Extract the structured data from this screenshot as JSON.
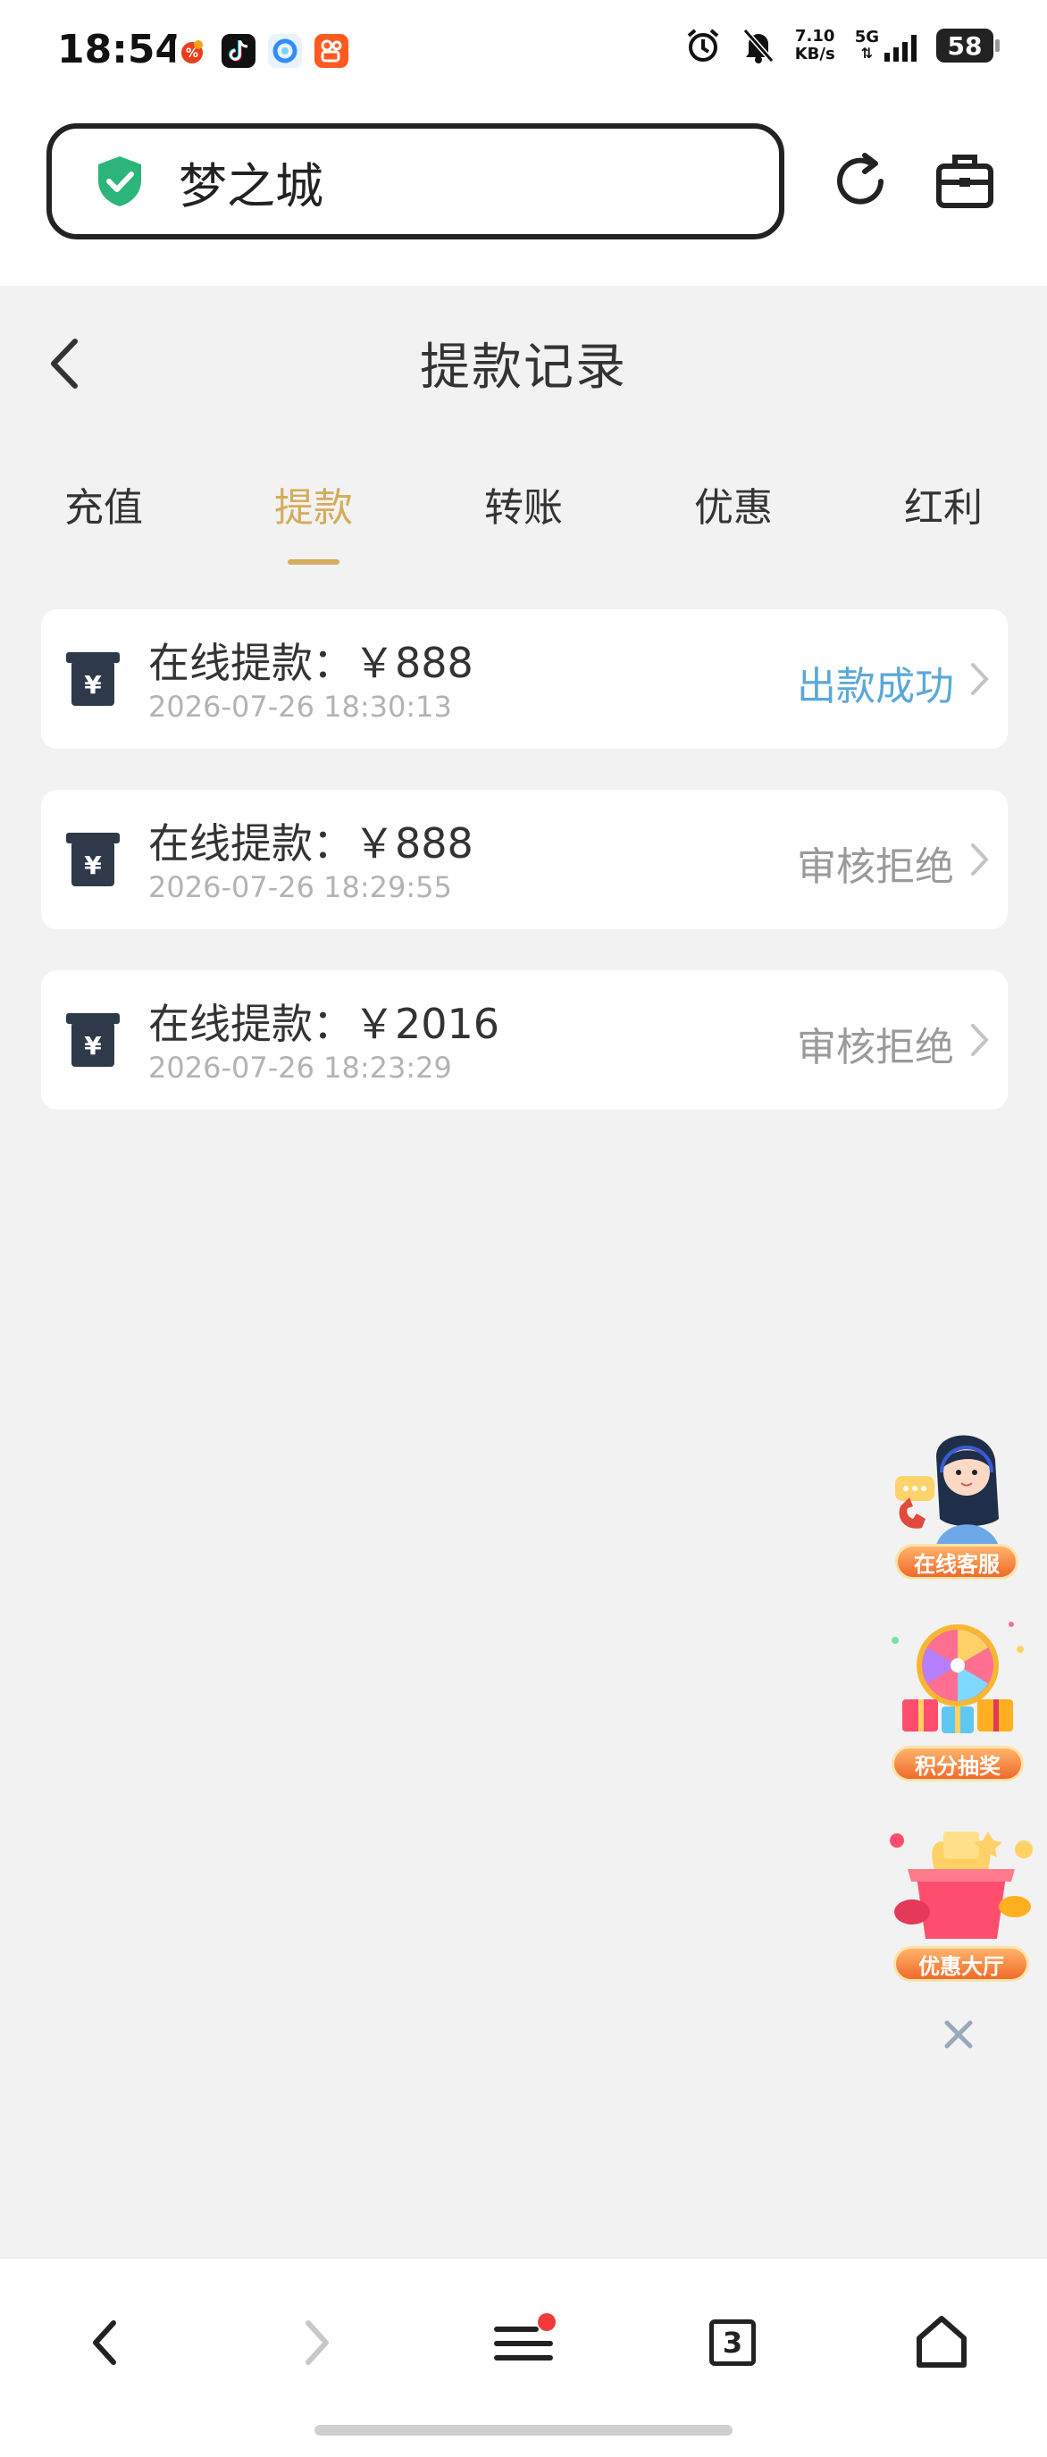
{
  "status_bar": {
    "time": "18:54",
    "net_speed_value": "7.10",
    "net_speed_unit": "KB/s",
    "network": "5G",
    "battery": "58",
    "app_icons": [
      "weibo-like-icon",
      "tiktok-icon",
      "browser-icon",
      "kuaishou-icon"
    ]
  },
  "browser": {
    "site_name": "梦之城"
  },
  "page": {
    "title": "提款记录"
  },
  "tabs": [
    {
      "label": "充值",
      "active": false
    },
    {
      "label": "提款",
      "active": true
    },
    {
      "label": "转账",
      "active": false
    },
    {
      "label": "优惠",
      "active": false
    },
    {
      "label": "红利",
      "active": false
    }
  ],
  "records": [
    {
      "title": "在线提款：￥888",
      "time": "2026-07-26 18:30:13",
      "status": "出款成功"
    },
    {
      "title": "在线提款：￥888",
      "time": "2026-07-26 18:29:55",
      "status": "审核拒绝"
    },
    {
      "title": "在线提款：￥2016",
      "time": "2026-07-26 18:23:29",
      "status": "审核拒绝"
    }
  ],
  "floating": {
    "customer_service": "在线客服",
    "lottery": "积分抽奖",
    "promo_hall": "优惠大厅"
  },
  "bottom_nav": {
    "tab_count": "3"
  },
  "colors": {
    "accent_gold": "#d5ac5a",
    "success_blue": "#5ba8d9",
    "rejected_gray": "#9a9a9a",
    "shield_green": "#2bb57a"
  }
}
